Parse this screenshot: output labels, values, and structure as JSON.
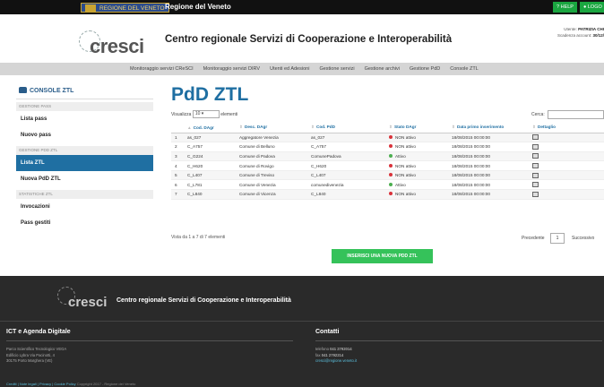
{
  "topbar": {
    "region_badge": "REGIONE DEL VENETO",
    "region_title": "Regione del Veneto",
    "help_label": "? HELP",
    "logout_label": "LOGO"
  },
  "header": {
    "logo_text": "cresci",
    "title": "Centro regionale Servizi di Cooperazione e Interoperabilità",
    "user_label": "Utente:",
    "user_name": "PATRIZIA CHI",
    "expiry_label": "Scadenza account:",
    "expiry_value": "30/12/"
  },
  "nav": {
    "items": [
      "Monitoraggio servizi CReSCI",
      "Monitoraggio servizi DIRV",
      "Utenti ed Adesioni",
      "Gestione servizi",
      "Gestione archivi",
      "Gestione PdD",
      "Console ZTL"
    ]
  },
  "sidebar": {
    "title": "CONSOLE ZTL",
    "sections": [
      {
        "label": "GESTIONE PASS",
        "items": [
          {
            "label": "Lista pass"
          },
          {
            "label": "Nuovo pass"
          }
        ]
      },
      {
        "label": "GESTIONE PDD ZTL",
        "items": [
          {
            "label": "Lista ZTL"
          },
          {
            "label": "Nuova PdD ZTL"
          }
        ]
      },
      {
        "label": "STATISTICHE ZTL",
        "items": [
          {
            "label": "Invocazioni"
          },
          {
            "label": "Pass gestiti"
          }
        ]
      }
    ]
  },
  "main": {
    "title": "PdD ZTL",
    "show_label": "Visualizza",
    "show_value": "10",
    "entries_label": "elementi",
    "search_label": "Cerca:",
    "columns": [
      "Cod. DAgr",
      "Desc. DAgr",
      "Cod. PdD",
      "Stato DAgr",
      "Data primo inserimento",
      "Dettaglio"
    ],
    "rows": [
      [
        "1",
        "as_027",
        "Aggregatore Venezia",
        "as_027",
        "NON attivo",
        "18/08/2015 00:00:00"
      ],
      [
        "2",
        "C_A757",
        "Comune di Belluno",
        "C_A757",
        "NON attivo",
        "18/08/2015 00:00:00"
      ],
      [
        "3",
        "C_G224",
        "Comune di Padova",
        "ComunePadova",
        "Attivo",
        "18/08/2015 00:00:00"
      ],
      [
        "4",
        "C_H620",
        "Comune di Rovigo",
        "C_H620",
        "NON attivo",
        "18/08/2015 00:00:00"
      ],
      [
        "5",
        "C_L407",
        "Comune di Treviso",
        "C_L407",
        "NON attivo",
        "18/08/2015 00:00:00"
      ],
      [
        "6",
        "C_L781",
        "Comune di Venezia",
        "comunedivenezia",
        "Attivo",
        "18/08/2015 00:00:00"
      ],
      [
        "7",
        "C_L840",
        "Comune di Vicenza",
        "C_L840",
        "NON attivo",
        "18/08/2015 00:00:00"
      ]
    ],
    "info": "Vista da 1 a 7 di 7 elementi",
    "prev_label": "Precedente",
    "page": "1",
    "next_label": "Successivo",
    "insert_button": "INSERISCI UNA NUOVA PDD ZTL"
  },
  "footer": {
    "logo_text": "cresci",
    "title": "Centro regionale Servizi di Cooperazione e Interoperabilità",
    "section1_title": "ICT e Agenda Digitale",
    "address": [
      "Parco Scientifico Tecnologico VEGA",
      "Edificio Lybra Via Pacinotti, 4",
      "30175 Porto Marghera (VE)"
    ],
    "section2_title": "Contatti",
    "phone_label": "telefono",
    "phone": "041 2792014",
    "fax_label": "fax",
    "fax": "041 2792214",
    "email": "cresci@regione.veneto.it",
    "bottom_links": "Crediti | Note legali | Privacy | Cookie Policy",
    "copyright": "Copyright 2017 - Regione del Veneto"
  },
  "colors": {
    "primary": "#1f6fa2",
    "green": "#35c25a",
    "status_active": "#4caf50",
    "status_inactive": "#d9323a"
  }
}
